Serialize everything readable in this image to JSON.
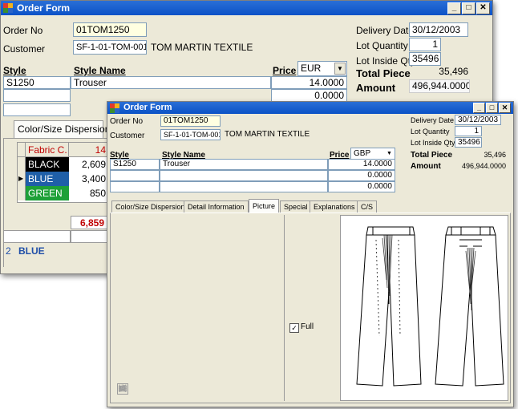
{
  "back": {
    "title": "Order Form",
    "order_no_label": "Order No",
    "order_no": "01TOM1250",
    "customer_label": "Customer",
    "customer_code": "SF-1-01-TOM-001",
    "customer_name": "TOM MARTIN TEXTILE",
    "delivery_date_label": "Delivery Date",
    "delivery_date": "30/12/2003",
    "lot_quantity_label": "Lot Quantity",
    "lot_quantity": "1",
    "lot_inside_label": "Lot Inside Qty.",
    "lot_inside": "35496",
    "style_label": "Style",
    "style_name_label": "Style Name",
    "price_label": "Price",
    "currency": "EUR",
    "style": "S1250",
    "style_name": "Trouser",
    "price1": "14.0000",
    "price2": "0.0000",
    "total_piece_label": "Total Piece",
    "total_piece": "35,496",
    "amount_label": "Amount",
    "amount": "496,944.0000",
    "tab_label": "Color/Size Dispersion",
    "grid_header": {
      "name": "Fabric C.",
      "value": "14"
    },
    "grid_rows": [
      {
        "name": "BLACK",
        "value": "2,609",
        "bg": "#000000",
        "fg": "#ffffff"
      },
      {
        "name": "BLUE",
        "value": "3,400",
        "bg": "#1f5fa8",
        "fg": "#ffffff"
      },
      {
        "name": "GREEN",
        "value": "850",
        "bg": "#1ea038",
        "fg": "#ffffff"
      }
    ],
    "row_marker": "▶",
    "grid_total": "6,859",
    "status_num": "2",
    "status_color": "BLUE"
  },
  "front": {
    "title": "Order Form",
    "order_no_label": "Order No",
    "order_no": "01TOM1250",
    "customer_label": "Customer",
    "customer_code": "SF-1-01-TOM-001",
    "customer_name": "TOM MARTIN TEXTILE",
    "delivery_date_label": "Delivery Date",
    "delivery_date": "30/12/2003",
    "lot_quantity_label": "Lot Quantity",
    "lot_quantity": "1",
    "lot_inside_label": "Lot Inside Qty.",
    "lot_inside": "35496",
    "style_label": "Style",
    "style_name_label": "Style Name",
    "price_label": "Price",
    "currency": "GBP",
    "style": "S1250",
    "style_name": "Trouser",
    "price1": "14.0000",
    "price2": "0.0000",
    "price3": "0.0000",
    "total_piece_label": "Total Piece",
    "total_piece": "35,496",
    "amount_label": "Amount",
    "amount": "496,944.0000",
    "tabs": [
      "Color/Size Dispersion",
      "Detail Information",
      "Picture",
      "Special",
      "Explanations",
      "C/S"
    ],
    "active_tab": "Picture",
    "full_label": "Full",
    "full_checked": true
  },
  "colors": {
    "titlebar": "#0b52c7",
    "window_bg": "#ece9d8",
    "highlight": "#ffffe1",
    "total_red": "#c00000",
    "header_red": "#c00000"
  },
  "icons": [
    "play-icon",
    "pause-icon",
    "stop-icon",
    "skip-end-icon",
    "first-frame-icon",
    "next-frame-icon",
    "previous-frame-icon",
    "loop-icon",
    "mute-icon"
  ]
}
